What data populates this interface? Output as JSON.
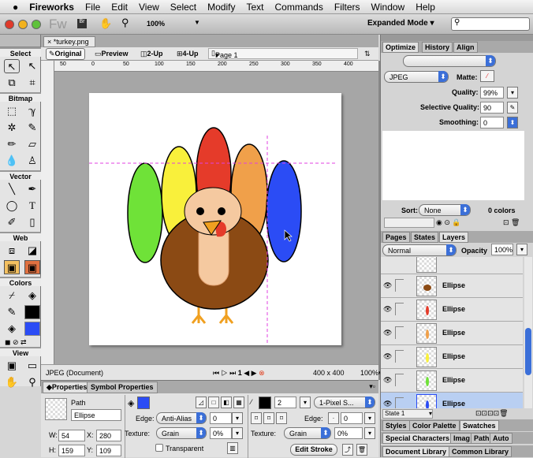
{
  "menubar": {
    "apple": "",
    "items": [
      "Fireworks",
      "File",
      "Edit",
      "View",
      "Select",
      "Modify",
      "Text",
      "Commands",
      "Filters",
      "Window",
      "Help"
    ]
  },
  "appbar": {
    "logo": "Fw",
    "zoom": "100%",
    "mode": "Expanded Mode",
    "search_placeholder": ""
  },
  "tools": {
    "sections": [
      "Select",
      "Bitmap",
      "Vector",
      "Web",
      "Colors",
      "View"
    ],
    "stroke_color": "#000000",
    "fill_color": "#2b4cf5"
  },
  "document": {
    "tab": "*turkey.png",
    "views": [
      "Original",
      "Preview",
      "2-Up",
      "4-Up"
    ],
    "page": "Page 1",
    "ruler": [
      "50",
      "0",
      "50",
      "100",
      "150",
      "200",
      "250",
      "300",
      "350",
      "400"
    ]
  },
  "canvas": {
    "colors": {
      "green": "#6fe238",
      "yellow": "#f9f03b",
      "red": "#e53b2a",
      "orange": "#f0a04a",
      "blue": "#2b4cf5",
      "body": "#8b4a14",
      "head": "#f5c9a0"
    }
  },
  "status": {
    "doc_type": "JPEG (Document)",
    "frame": "1",
    "size": "400 x 400",
    "zoom": "100%"
  },
  "properties": {
    "tabs": [
      "Properties",
      "Symbol Properties"
    ],
    "object_type": "Path",
    "name": "Ellipse",
    "w_label": "W:",
    "w": "54",
    "x_label": "X:",
    "x": "280",
    "h_label": "H:",
    "h": "159",
    "y_label": "Y:",
    "y": "109",
    "fill": {
      "edge_label": "Edge:",
      "edge": "Anti-Alias",
      "edge_value": "0",
      "texture_label": "Texture:",
      "texture": "Grain",
      "texture_value": "0%",
      "transparent": "Transparent"
    },
    "stroke": {
      "size": "2",
      "type": "1-Pixel S...",
      "edge_label": "Edge:",
      "edge_value": "0",
      "texture_label": "Texture:",
      "texture": "Grain",
      "texture_value": "0%",
      "edit": "Edit Stroke"
    }
  },
  "optimize": {
    "tabs": [
      "Optimize",
      "History",
      "Align"
    ],
    "format": "JPEG",
    "matte_label": "Matte:",
    "quality_label": "Quality:",
    "quality": "99%",
    "selective_label": "Selective Quality:",
    "selective": "90",
    "smoothing_label": "Smoothing:",
    "smoothing": "0",
    "sort_label": "Sort:",
    "sort": "None",
    "colors": "0 colors"
  },
  "layers": {
    "tabs": [
      "Pages",
      "States",
      "Layers"
    ],
    "blend": "Normal",
    "opacity_label": "Opacity",
    "opacity": "100%",
    "items": [
      "Ellipse",
      "Ellipse",
      "Ellipse",
      "Ellipse",
      "Ellipse",
      "Ellipse"
    ],
    "state": "State 1"
  },
  "bottom_panels": {
    "row1": [
      "Styles",
      "Color Palette",
      "Swatches"
    ],
    "row2": [
      "Special Characters",
      "Imag",
      "Path",
      "Auto"
    ],
    "row3": [
      "Document Library",
      "Common Library"
    ]
  }
}
